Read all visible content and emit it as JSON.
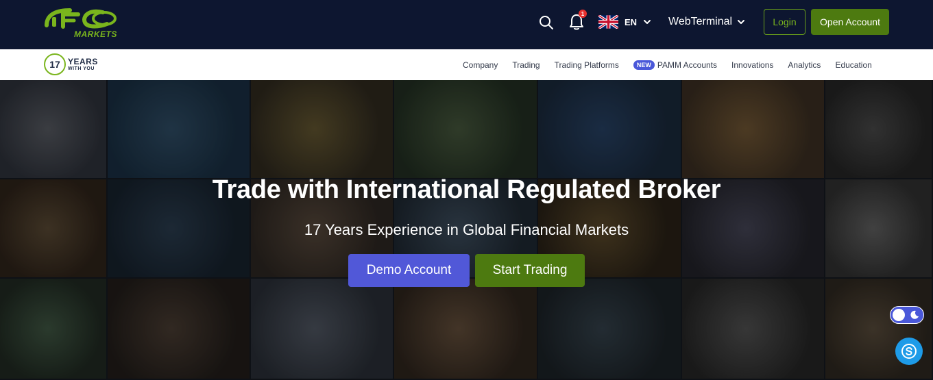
{
  "header": {
    "logo_text": "IFC",
    "logo_sub": "MARKETS",
    "notification_count": "1",
    "language": "EN",
    "webterminal_label": "WebTerminal",
    "login_label": "Login",
    "open_account_label": "Open Account"
  },
  "navbar": {
    "years_number": "17",
    "years_big": "YEARS",
    "years_small": "WITH YOU",
    "items": [
      {
        "label": "Company"
      },
      {
        "label": "Trading"
      },
      {
        "label": "Trading Platforms"
      },
      {
        "label": "PAMM Accounts",
        "badge": "NEW"
      },
      {
        "label": "Innovations"
      },
      {
        "label": "Analytics"
      },
      {
        "label": "Education"
      }
    ]
  },
  "hero": {
    "title": "Trade with International Regulated Broker",
    "subtitle": "17 Years Experience in Global Financial Markets",
    "demo_label": "Demo Account",
    "start_label": "Start Trading"
  },
  "colors": {
    "header_bg": "#0d1630",
    "brand_green": "#7ab51d",
    "button_green": "#4d7a10",
    "accent_blue": "#5158d8",
    "skype_blue": "#1e9be8"
  },
  "icons": [
    "search-icon",
    "bell-icon",
    "uk-flag-icon",
    "chevron-down-icon",
    "moon-icon",
    "skype-icon"
  ]
}
